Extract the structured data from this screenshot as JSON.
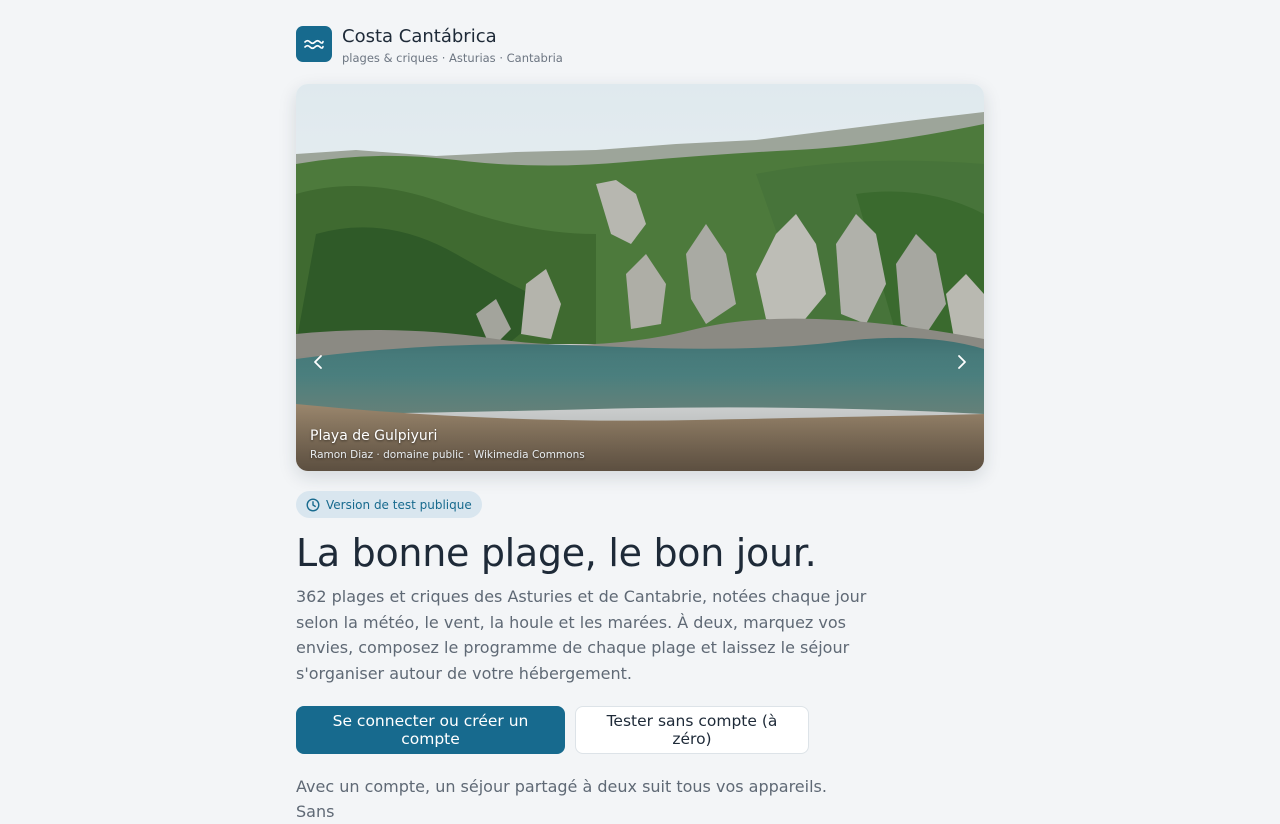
{
  "brand": {
    "logo_icon": "waves-icon",
    "title": "Costa Cantábrica",
    "subtitle": "plages & criques · Asturias · Cantabria"
  },
  "hero": {
    "title": "Playa de Gulpiyuri",
    "credit": "Ramon Diaz · domaine public · Wikimedia Commons",
    "prev_icon": "chevron-left-icon",
    "next_icon": "chevron-right-icon"
  },
  "badge": {
    "icon": "clock-icon",
    "label": "Version de test publique"
  },
  "headline": "La bonne plage, le bon jour.",
  "lead": "362 plages et criques des Asturies et de Cantabrie, notées chaque jour selon la météo, le vent, la houle et les marées. À deux, marquez vos envies, composez le programme de chaque plage et laissez le séjour s'organiser autour de votre hébergement.",
  "actions": {
    "primary_label": "Se connecter ou créer un compte",
    "secondary_label": "Tester sans compte (à zéro)"
  },
  "footnote": "Avec un compte, un séjour partagé à deux suit tous vos appareils. Sans",
  "colors": {
    "accent": "#176a8e",
    "background": "#f3f5f7",
    "badge_bg": "#d9e6ef"
  }
}
